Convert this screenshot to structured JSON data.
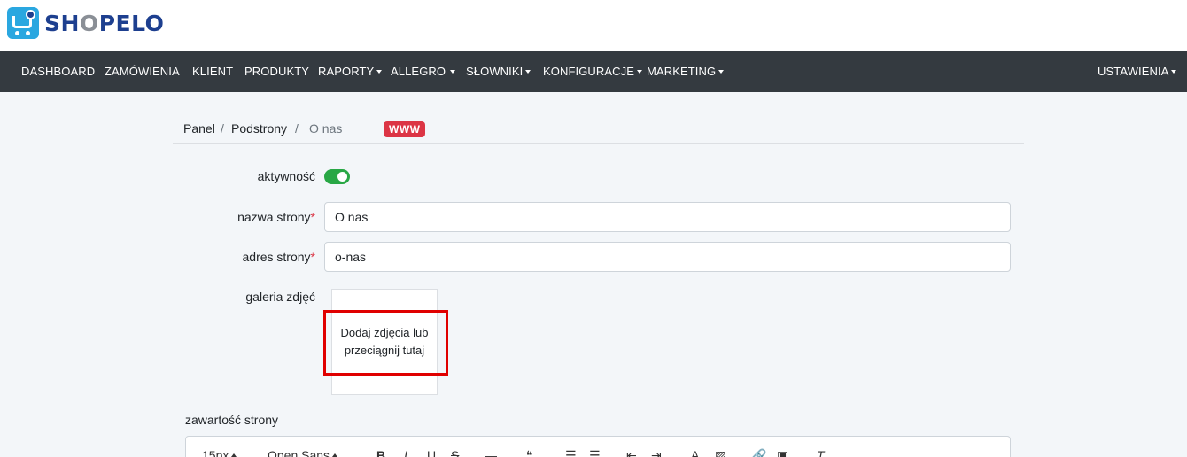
{
  "brand": {
    "name_part1": "SH",
    "name_o": "O",
    "name_part2": "PELO"
  },
  "nav": {
    "items": [
      {
        "label": "DASHBOARD",
        "dropdown": false
      },
      {
        "label": "ZAMÓWIENIA",
        "dropdown": false
      },
      {
        "label": "KLIENT",
        "dropdown": false
      },
      {
        "label": "PRODUKTY",
        "dropdown": false
      },
      {
        "label": "RAPORTY",
        "dropdown": true
      },
      {
        "label": "ALLEGRO",
        "dropdown": true
      },
      {
        "label": "SŁOWNIKI",
        "dropdown": true
      },
      {
        "label": "KONFIGURACJE",
        "dropdown": true
      },
      {
        "label": "MARKETING",
        "dropdown": true
      }
    ],
    "right": {
      "label": "USTAWIENIA",
      "dropdown": true
    }
  },
  "breadcrumb": {
    "items": [
      "Panel",
      "Podstrony",
      "O nas"
    ],
    "separator": "/",
    "badge": "WWW"
  },
  "form": {
    "active": {
      "label": "aktywność",
      "checked": true
    },
    "page_name": {
      "label": "nazwa strony",
      "required_mark": "*",
      "value": "O nas"
    },
    "page_address": {
      "label": "adres strony",
      "required_mark": "*",
      "value": "o-nas"
    },
    "gallery": {
      "label": "galeria zdjęć",
      "dropzone_line1": "Dodaj zdjęcia lub",
      "dropzone_line2": "przeciągnij tutaj"
    },
    "content": {
      "label": "zawartość strony"
    }
  },
  "editor_toolbar": {
    "font_size": "15px",
    "font_family": "Open Sans",
    "bold": "B",
    "italic": "I",
    "underline": "U",
    "strike": "S",
    "hr": "—",
    "quote": "❝",
    "ol": "☰",
    "ul": "☰",
    "outdent": "⇤",
    "indent": "⇥",
    "font_color": "A",
    "bg_color": "▨",
    "link": "🔗",
    "image": "▣",
    "clear": "T"
  },
  "colors": {
    "navbar": "#343a40",
    "accent": "#28a745",
    "badge": "#dc3545",
    "highlight": "#e00000",
    "brand": "#1d3f8f"
  }
}
